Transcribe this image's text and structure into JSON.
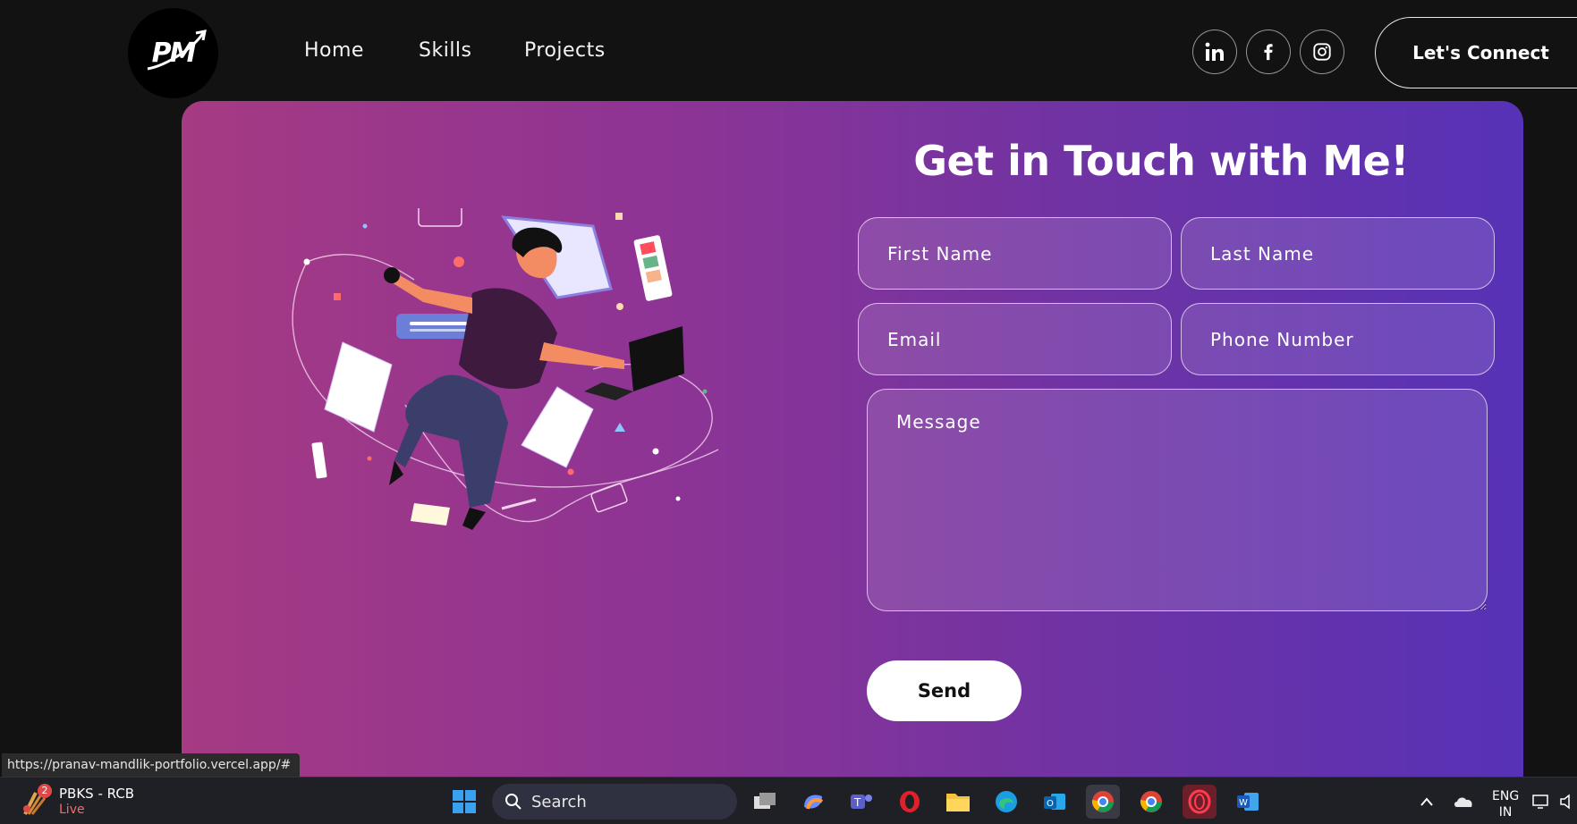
{
  "nav": {
    "logo_text": "PM",
    "links": [
      "Home",
      "Skills",
      "Projects"
    ],
    "social": [
      "linkedin-icon",
      "facebook-icon",
      "instagram-icon"
    ],
    "connect_label": "Let's Connect"
  },
  "contact": {
    "title": "Get in Touch with Me!",
    "placeholders": {
      "first_name": "First Name",
      "last_name": "Last Name",
      "email": "Email",
      "phone": "Phone Number",
      "message": "Message"
    },
    "send_label": "Send"
  },
  "status_url": "https://pranav-mandlik-portfolio.vercel.app/#",
  "taskbar": {
    "weather_title": "PBKS - RCB",
    "weather_subtitle": "Live",
    "weather_badge": "2",
    "search_label": "Search",
    "lang_line1": "ENG",
    "lang_line2": "IN",
    "icons": [
      "windows-start-icon",
      "search-icon",
      "task-view-icon",
      "copilot-icon",
      "teams-icon",
      "opera-icon",
      "file-explorer-icon",
      "edge-icon",
      "outlook-icon",
      "chrome-icon",
      "chrome-profile-icon",
      "opera-gx-icon",
      "word-icon",
      "chevron-up-icon",
      "onedrive-icon",
      "network-icon",
      "volume-icon"
    ]
  },
  "colors": {
    "page_bg": "#121212",
    "gradient_start": "#a63a83",
    "gradient_end": "#5732b6",
    "taskbar_bg": "#1f1f26"
  }
}
